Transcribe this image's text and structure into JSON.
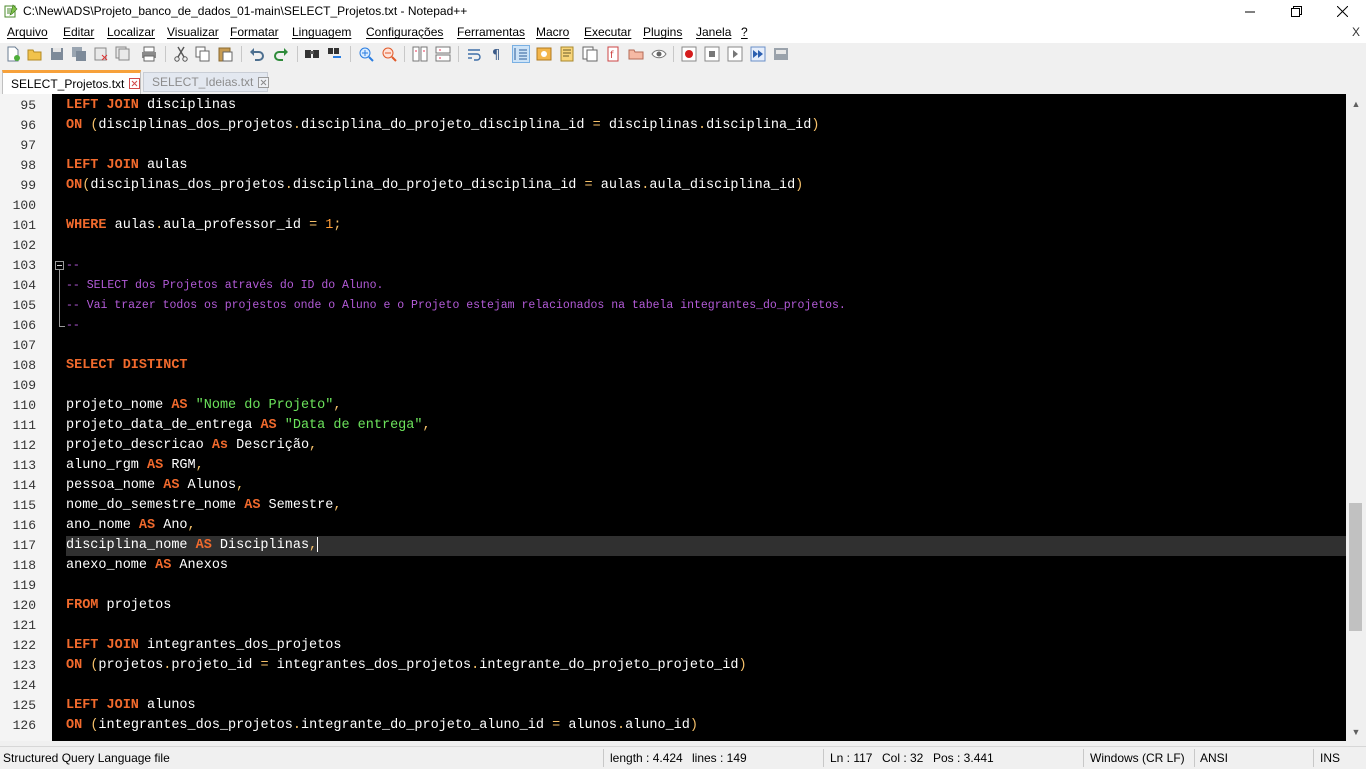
{
  "window": {
    "title": "C:\\New\\ADS\\Projeto_banco_de_dados_01-main\\SELECT_Projetos.txt - Notepad++"
  },
  "menu": [
    "Arquivo",
    "Editar",
    "Localizar",
    "Visualizar",
    "Formatar",
    "Linguagem",
    "Configurações",
    "Ferramentas",
    "Macro",
    "Executar",
    "Plugins",
    "Janela",
    "?"
  ],
  "menu_close": "X",
  "toolbar_icons": [
    "new-file-icon",
    "open-file-icon",
    "save-icon",
    "save-all-icon",
    "close-icon",
    "close-all-icon",
    "print-icon",
    "cut-icon",
    "copy-icon",
    "paste-icon",
    "undo-icon",
    "redo-icon",
    "find-icon",
    "replace-icon",
    "zoom-in-icon",
    "zoom-out-icon",
    "sync-vertical-icon",
    "sync-horizontal-icon",
    "word-wrap-icon",
    "show-all-characters-icon",
    "indent-guide-icon",
    "language-icon",
    "document-map-icon",
    "function-list-icon",
    "folder-workspace-icon",
    "monitoring-icon",
    "record-macro-icon",
    "stop-macro-icon",
    "play-macro-icon",
    "run-macro-multiple-icon",
    "save-macro-icon"
  ],
  "tabs": [
    {
      "label": "SELECT_Projetos.txt",
      "active": true
    },
    {
      "label": "SELECT_Ideias.txt",
      "active": false
    }
  ],
  "editor": {
    "current_line": 117,
    "lines": [
      {
        "n": "95",
        "segs": [
          [
            "kw",
            "LEFT JOIN"
          ],
          [
            "t",
            " disciplinas"
          ]
        ]
      },
      {
        "n": "96",
        "segs": [
          [
            "kw",
            "ON"
          ],
          [
            "t",
            " "
          ],
          [
            "op",
            "("
          ],
          [
            "t",
            "disciplinas_dos_projetos"
          ],
          [
            "op",
            "."
          ],
          [
            "t",
            "disciplina_do_projeto_disciplina_id "
          ],
          [
            "op",
            "="
          ],
          [
            "t",
            " disciplinas"
          ],
          [
            "op",
            "."
          ],
          [
            "t",
            "disciplina_id"
          ],
          [
            "op",
            ")"
          ]
        ]
      },
      {
        "n": "97",
        "segs": []
      },
      {
        "n": "98",
        "segs": [
          [
            "kw",
            "LEFT JOIN"
          ],
          [
            "t",
            " aulas"
          ]
        ]
      },
      {
        "n": "99",
        "segs": [
          [
            "kw",
            "ON"
          ],
          [
            "op",
            "("
          ],
          [
            "t",
            "disciplinas_dos_projetos"
          ],
          [
            "op",
            "."
          ],
          [
            "t",
            "disciplina_do_projeto_disciplina_id "
          ],
          [
            "op",
            "="
          ],
          [
            "t",
            " aulas"
          ],
          [
            "op",
            "."
          ],
          [
            "t",
            "aula_disciplina_id"
          ],
          [
            "op",
            ")"
          ]
        ]
      },
      {
        "n": "100",
        "segs": []
      },
      {
        "n": "101",
        "segs": [
          [
            "kw",
            "WHERE"
          ],
          [
            "t",
            " aulas"
          ],
          [
            "op",
            "."
          ],
          [
            "t",
            "aula_professor_id "
          ],
          [
            "op",
            "="
          ],
          [
            "t",
            " "
          ],
          [
            "num",
            "1"
          ],
          [
            "op",
            ";"
          ]
        ]
      },
      {
        "n": "102",
        "segs": []
      },
      {
        "n": "103",
        "segs": [
          [
            "cm",
            "--"
          ]
        ]
      },
      {
        "n": "104",
        "segs": [
          [
            "cm",
            "-- SELECT dos Projetos através do ID do Aluno."
          ]
        ]
      },
      {
        "n": "105",
        "segs": [
          [
            "cm",
            "-- Vai trazer todos os projestos onde o Aluno e o Projeto estejam relacionados na tabela integrantes_do_projetos."
          ]
        ]
      },
      {
        "n": "106",
        "segs": [
          [
            "cm",
            "--"
          ]
        ]
      },
      {
        "n": "107",
        "segs": []
      },
      {
        "n": "108",
        "segs": [
          [
            "kw",
            "SELECT DISTINCT"
          ]
        ]
      },
      {
        "n": "109",
        "segs": []
      },
      {
        "n": "110",
        "segs": [
          [
            "t",
            "projeto_nome "
          ],
          [
            "kw",
            "AS"
          ],
          [
            "t",
            " "
          ],
          [
            "str",
            "\"Nome do Projeto\""
          ],
          [
            "op",
            ","
          ]
        ]
      },
      {
        "n": "111",
        "segs": [
          [
            "t",
            "projeto_data_de_entrega "
          ],
          [
            "kw",
            "AS"
          ],
          [
            "t",
            " "
          ],
          [
            "str",
            "\"Data de entrega\""
          ],
          [
            "op",
            ","
          ]
        ]
      },
      {
        "n": "112",
        "segs": [
          [
            "t",
            "projeto_descricao "
          ],
          [
            "kw",
            "As"
          ],
          [
            "t",
            " Descrição"
          ],
          [
            "op",
            ","
          ]
        ]
      },
      {
        "n": "113",
        "segs": [
          [
            "t",
            "aluno_rgm "
          ],
          [
            "kw",
            "AS"
          ],
          [
            "t",
            " RGM"
          ],
          [
            "op",
            ","
          ]
        ]
      },
      {
        "n": "114",
        "segs": [
          [
            "t",
            "pessoa_nome "
          ],
          [
            "kw",
            "AS"
          ],
          [
            "t",
            " Alunos"
          ],
          [
            "op",
            ","
          ]
        ]
      },
      {
        "n": "115",
        "segs": [
          [
            "t",
            "nome_do_semestre_nome "
          ],
          [
            "kw",
            "AS"
          ],
          [
            "t",
            " Semestre"
          ],
          [
            "op",
            ","
          ]
        ]
      },
      {
        "n": "116",
        "segs": [
          [
            "t",
            "ano_nome "
          ],
          [
            "kw",
            "AS"
          ],
          [
            "t",
            " Ano"
          ],
          [
            "op",
            ","
          ]
        ]
      },
      {
        "n": "117",
        "segs": [
          [
            "t",
            "disciplina_nome "
          ],
          [
            "kw",
            "AS"
          ],
          [
            "t",
            " Disciplinas"
          ],
          [
            "op",
            ","
          ]
        ]
      },
      {
        "n": "118",
        "segs": [
          [
            "t",
            "anexo_nome "
          ],
          [
            "kw",
            "AS"
          ],
          [
            "t",
            " Anexos"
          ]
        ]
      },
      {
        "n": "119",
        "segs": []
      },
      {
        "n": "120",
        "segs": [
          [
            "kw",
            "FROM"
          ],
          [
            "t",
            " projetos"
          ]
        ]
      },
      {
        "n": "121",
        "segs": []
      },
      {
        "n": "122",
        "segs": [
          [
            "kw",
            "LEFT JOIN"
          ],
          [
            "t",
            " integrantes_dos_projetos"
          ]
        ]
      },
      {
        "n": "123",
        "segs": [
          [
            "kw",
            "ON"
          ],
          [
            "t",
            " "
          ],
          [
            "op",
            "("
          ],
          [
            "t",
            "projetos"
          ],
          [
            "op",
            "."
          ],
          [
            "t",
            "projeto_id "
          ],
          [
            "op",
            "="
          ],
          [
            "t",
            " integrantes_dos_projetos"
          ],
          [
            "op",
            "."
          ],
          [
            "t",
            "integrante_do_projeto_projeto_id"
          ],
          [
            "op",
            ")"
          ]
        ]
      },
      {
        "n": "124",
        "segs": []
      },
      {
        "n": "125",
        "segs": [
          [
            "kw",
            "LEFT JOIN"
          ],
          [
            "t",
            " alunos"
          ]
        ]
      },
      {
        "n": "126",
        "segs": [
          [
            "kw",
            "ON"
          ],
          [
            "t",
            " "
          ],
          [
            "op",
            "("
          ],
          [
            "t",
            "integrantes_dos_projetos"
          ],
          [
            "op",
            "."
          ],
          [
            "t",
            "integrante_do_projeto_aluno_id "
          ],
          [
            "op",
            "="
          ],
          [
            "t",
            " alunos"
          ],
          [
            "op",
            "."
          ],
          [
            "t",
            "aluno_id"
          ],
          [
            "op",
            ")"
          ]
        ]
      }
    ]
  },
  "status": {
    "file_type": "Structured Query Language file",
    "length": "length : 4.424",
    "lines": "lines : 149",
    "ln": "Ln : 117",
    "col": "Col : 32",
    "pos": "Pos : 3.441",
    "eol": "Windows (CR LF)",
    "encoding": "ANSI",
    "mode": "INS"
  },
  "colors": {
    "keyword": "#f16a2d",
    "string": "#6ce35c",
    "number": "#ff9d37",
    "operator": "#f6c16a",
    "comment": "#b35bd8",
    "editor_bg": "#000000",
    "tab_accent": "#f7a13a"
  }
}
